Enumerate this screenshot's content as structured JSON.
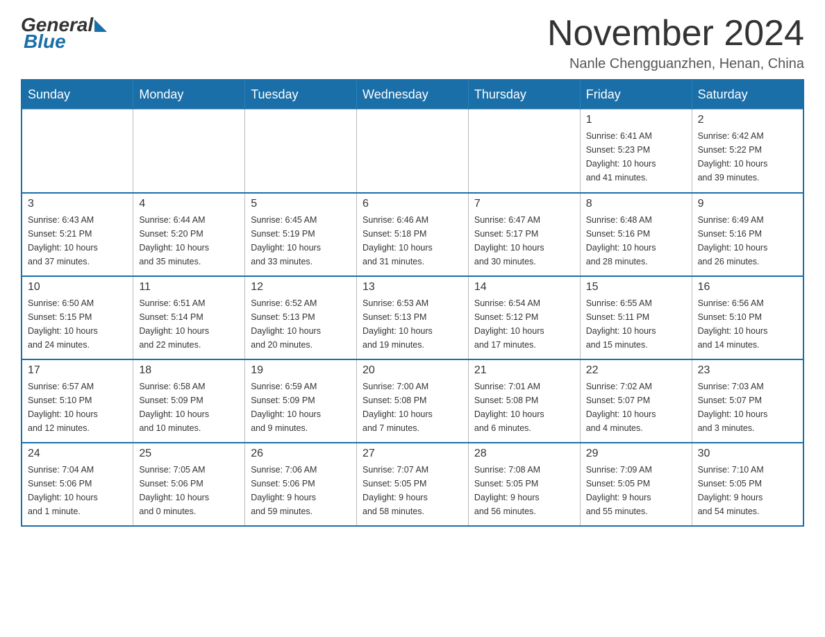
{
  "header": {
    "logo": {
      "general": "General",
      "blue": "Blue"
    },
    "title": "November 2024",
    "location": "Nanle Chengguanzhen, Henan, China"
  },
  "weekdays": [
    "Sunday",
    "Monday",
    "Tuesday",
    "Wednesday",
    "Thursday",
    "Friday",
    "Saturday"
  ],
  "weeks": [
    {
      "days": [
        {
          "number": "",
          "info": ""
        },
        {
          "number": "",
          "info": ""
        },
        {
          "number": "",
          "info": ""
        },
        {
          "number": "",
          "info": ""
        },
        {
          "number": "",
          "info": ""
        },
        {
          "number": "1",
          "info": "Sunrise: 6:41 AM\nSunset: 5:23 PM\nDaylight: 10 hours\nand 41 minutes."
        },
        {
          "number": "2",
          "info": "Sunrise: 6:42 AM\nSunset: 5:22 PM\nDaylight: 10 hours\nand 39 minutes."
        }
      ]
    },
    {
      "days": [
        {
          "number": "3",
          "info": "Sunrise: 6:43 AM\nSunset: 5:21 PM\nDaylight: 10 hours\nand 37 minutes."
        },
        {
          "number": "4",
          "info": "Sunrise: 6:44 AM\nSunset: 5:20 PM\nDaylight: 10 hours\nand 35 minutes."
        },
        {
          "number": "5",
          "info": "Sunrise: 6:45 AM\nSunset: 5:19 PM\nDaylight: 10 hours\nand 33 minutes."
        },
        {
          "number": "6",
          "info": "Sunrise: 6:46 AM\nSunset: 5:18 PM\nDaylight: 10 hours\nand 31 minutes."
        },
        {
          "number": "7",
          "info": "Sunrise: 6:47 AM\nSunset: 5:17 PM\nDaylight: 10 hours\nand 30 minutes."
        },
        {
          "number": "8",
          "info": "Sunrise: 6:48 AM\nSunset: 5:16 PM\nDaylight: 10 hours\nand 28 minutes."
        },
        {
          "number": "9",
          "info": "Sunrise: 6:49 AM\nSunset: 5:16 PM\nDaylight: 10 hours\nand 26 minutes."
        }
      ]
    },
    {
      "days": [
        {
          "number": "10",
          "info": "Sunrise: 6:50 AM\nSunset: 5:15 PM\nDaylight: 10 hours\nand 24 minutes."
        },
        {
          "number": "11",
          "info": "Sunrise: 6:51 AM\nSunset: 5:14 PM\nDaylight: 10 hours\nand 22 minutes."
        },
        {
          "number": "12",
          "info": "Sunrise: 6:52 AM\nSunset: 5:13 PM\nDaylight: 10 hours\nand 20 minutes."
        },
        {
          "number": "13",
          "info": "Sunrise: 6:53 AM\nSunset: 5:13 PM\nDaylight: 10 hours\nand 19 minutes."
        },
        {
          "number": "14",
          "info": "Sunrise: 6:54 AM\nSunset: 5:12 PM\nDaylight: 10 hours\nand 17 minutes."
        },
        {
          "number": "15",
          "info": "Sunrise: 6:55 AM\nSunset: 5:11 PM\nDaylight: 10 hours\nand 15 minutes."
        },
        {
          "number": "16",
          "info": "Sunrise: 6:56 AM\nSunset: 5:10 PM\nDaylight: 10 hours\nand 14 minutes."
        }
      ]
    },
    {
      "days": [
        {
          "number": "17",
          "info": "Sunrise: 6:57 AM\nSunset: 5:10 PM\nDaylight: 10 hours\nand 12 minutes."
        },
        {
          "number": "18",
          "info": "Sunrise: 6:58 AM\nSunset: 5:09 PM\nDaylight: 10 hours\nand 10 minutes."
        },
        {
          "number": "19",
          "info": "Sunrise: 6:59 AM\nSunset: 5:09 PM\nDaylight: 10 hours\nand 9 minutes."
        },
        {
          "number": "20",
          "info": "Sunrise: 7:00 AM\nSunset: 5:08 PM\nDaylight: 10 hours\nand 7 minutes."
        },
        {
          "number": "21",
          "info": "Sunrise: 7:01 AM\nSunset: 5:08 PM\nDaylight: 10 hours\nand 6 minutes."
        },
        {
          "number": "22",
          "info": "Sunrise: 7:02 AM\nSunset: 5:07 PM\nDaylight: 10 hours\nand 4 minutes."
        },
        {
          "number": "23",
          "info": "Sunrise: 7:03 AM\nSunset: 5:07 PM\nDaylight: 10 hours\nand 3 minutes."
        }
      ]
    },
    {
      "days": [
        {
          "number": "24",
          "info": "Sunrise: 7:04 AM\nSunset: 5:06 PM\nDaylight: 10 hours\nand 1 minute."
        },
        {
          "number": "25",
          "info": "Sunrise: 7:05 AM\nSunset: 5:06 PM\nDaylight: 10 hours\nand 0 minutes."
        },
        {
          "number": "26",
          "info": "Sunrise: 7:06 AM\nSunset: 5:06 PM\nDaylight: 9 hours\nand 59 minutes."
        },
        {
          "number": "27",
          "info": "Sunrise: 7:07 AM\nSunset: 5:05 PM\nDaylight: 9 hours\nand 58 minutes."
        },
        {
          "number": "28",
          "info": "Sunrise: 7:08 AM\nSunset: 5:05 PM\nDaylight: 9 hours\nand 56 minutes."
        },
        {
          "number": "29",
          "info": "Sunrise: 7:09 AM\nSunset: 5:05 PM\nDaylight: 9 hours\nand 55 minutes."
        },
        {
          "number": "30",
          "info": "Sunrise: 7:10 AM\nSunset: 5:05 PM\nDaylight: 9 hours\nand 54 minutes."
        }
      ]
    }
  ]
}
